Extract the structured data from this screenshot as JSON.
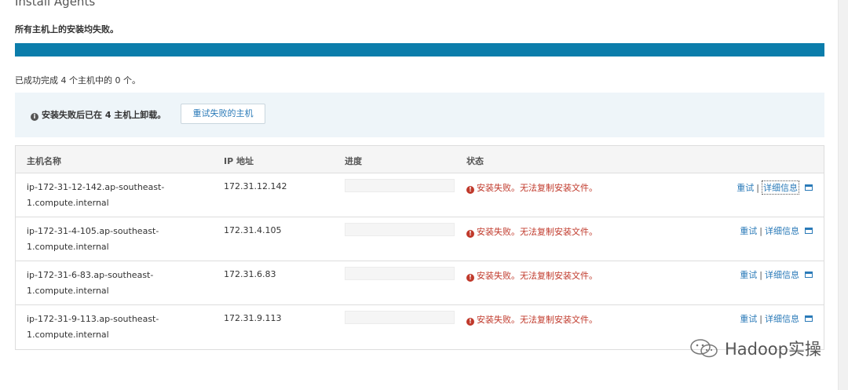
{
  "header": {
    "title": "Install Agents",
    "summary": "所有主机上的安装均失败。",
    "completed": "已成功完成 4 个主机中的 0 个。"
  },
  "progress": {
    "percent": 100,
    "color": "#0b7dab"
  },
  "alert": {
    "message": "安装失败后已在 4 主机上卸载。",
    "retry_failed_label": "重试失败的主机"
  },
  "table": {
    "columns": {
      "host": "主机名称",
      "ip": "IP 地址",
      "progress": "进度",
      "status": "状态"
    },
    "rows": [
      {
        "host_line1": "ip-172-31-12-142.ap-southeast-",
        "host_line2": "1.compute.internal",
        "ip": "172.31.12.142",
        "status": "安装失败。无法复制安装文件。",
        "retry": "重试",
        "sep": "|",
        "details": "详细信息"
      },
      {
        "host_line1": "ip-172-31-4-105.ap-southeast-",
        "host_line2": "1.compute.internal",
        "ip": "172.31.4.105",
        "status": "安装失败。无法复制安装文件。",
        "retry": "重试",
        "sep": "|",
        "details": "详细信息"
      },
      {
        "host_line1": "ip-172-31-6-83.ap-southeast-",
        "host_line2": "1.compute.internal",
        "ip": "172.31.6.83",
        "status": "安装失败。无法复制安装文件。",
        "retry": "重试",
        "sep": "|",
        "details": "详细信息"
      },
      {
        "host_line1": "ip-172-31-9-113.ap-southeast-",
        "host_line2": "1.compute.internal",
        "ip": "172.31.9.113",
        "status": "安装失败。无法复制安装文件。",
        "retry": "重试",
        "sep": "|",
        "details": "详细信息"
      }
    ]
  },
  "watermark": {
    "text": "Hadoop实操",
    "icon": "wechat-icon"
  },
  "colors": {
    "error": "#c0392b",
    "link": "#2a7ab8"
  }
}
